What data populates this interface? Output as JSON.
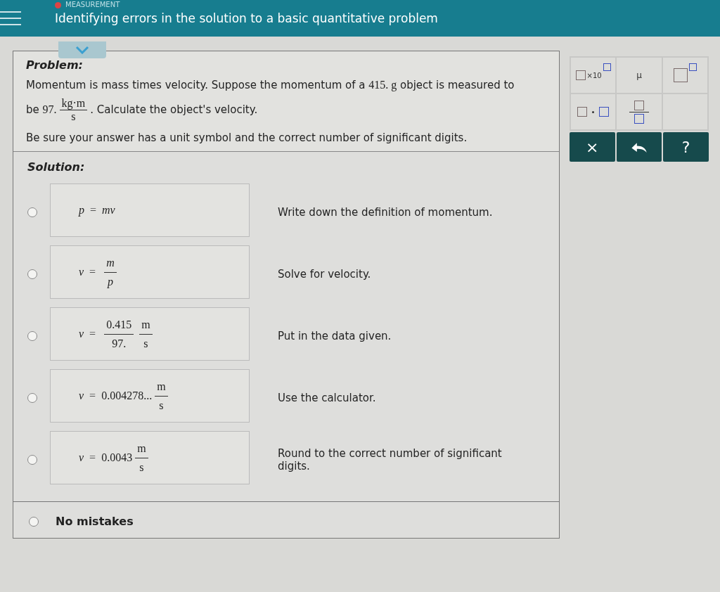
{
  "header": {
    "category": "MEASUREMENT",
    "title": "Identifying errors in the solution to a basic quantitative problem"
  },
  "problem": {
    "heading": "Problem:",
    "sentence": [
      {
        "kind": "text",
        "text": "Momentum is mass times velocity. Suppose the momentum of a "
      },
      {
        "kind": "math",
        "text": "415. g"
      },
      {
        "kind": "text",
        "text": " object is measured to be "
      },
      {
        "kind": "math",
        "text": "97."
      },
      {
        "kind": "frac",
        "num": "kg·m",
        "den": "s"
      },
      {
        "kind": "text",
        "text": ". Calculate the object's velocity."
      }
    ],
    "note": "Be sure your answer has a unit symbol and the correct number of significant digits."
  },
  "solution": {
    "heading": "Solution:",
    "steps": [
      {
        "selected": false,
        "explanation": "Write down the definition of momentum.",
        "math": [
          {
            "kind": "italic",
            "text": "p"
          },
          {
            "kind": "op",
            "text": "="
          },
          {
            "kind": "italic",
            "text": "mv"
          }
        ]
      },
      {
        "selected": false,
        "explanation": "Solve for velocity.",
        "math": [
          {
            "kind": "italic",
            "text": "v"
          },
          {
            "kind": "op",
            "text": "="
          },
          {
            "kind": "frac",
            "num": "m",
            "den": "p",
            "italic": true
          }
        ]
      },
      {
        "selected": false,
        "explanation": "Put in the data given.",
        "math": [
          {
            "kind": "italic",
            "text": "v"
          },
          {
            "kind": "op",
            "text": "="
          },
          {
            "kind": "frac",
            "num": "0.415",
            "den": "97.",
            "italic": false
          },
          {
            "kind": "frac",
            "num": "m",
            "den": "s",
            "italic": false
          }
        ]
      },
      {
        "selected": false,
        "explanation": "Use the calculator.",
        "math": [
          {
            "kind": "italic",
            "text": "v"
          },
          {
            "kind": "op",
            "text": "="
          },
          {
            "kind": "roman",
            "text": "0.004278..."
          },
          {
            "kind": "frac",
            "num": "m",
            "den": "s",
            "italic": false
          }
        ]
      },
      {
        "selected": false,
        "explanation": "Round to the correct number of significant digits.",
        "math": [
          {
            "kind": "italic",
            "text": "v"
          },
          {
            "kind": "op",
            "text": "="
          },
          {
            "kind": "roman",
            "text": "0.0043"
          },
          {
            "kind": "frac",
            "num": "m",
            "den": "s",
            "italic": false
          }
        ]
      }
    ],
    "no_mistakes": {
      "selected": false,
      "label": "No mistakes"
    }
  },
  "keypad": {
    "keys": [
      {
        "kind": "sci",
        "text": "×10"
      },
      {
        "kind": "char",
        "text": "μ"
      },
      {
        "kind": "power"
      },
      {
        "kind": "dot"
      },
      {
        "kind": "fraction"
      },
      {
        "kind": "empty"
      }
    ],
    "actions": [
      {
        "kind": "char",
        "text": "×"
      },
      {
        "kind": "undo"
      },
      {
        "kind": "char",
        "text": "?"
      }
    ]
  }
}
